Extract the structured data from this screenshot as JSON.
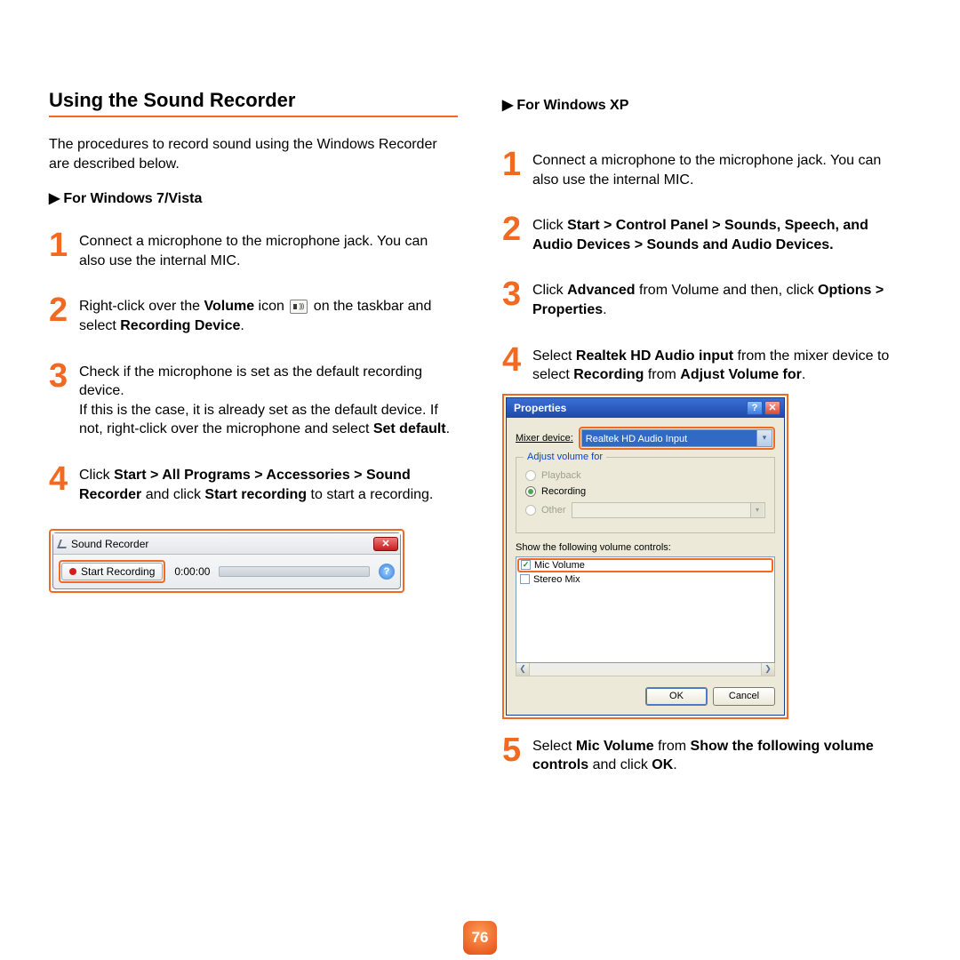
{
  "page_number": "76",
  "left": {
    "title": "Using the Sound Recorder",
    "intro": "The procedures to record sound using the Windows Recorder are described below.",
    "sub_heading": "For Windows 7/Vista",
    "steps": [
      {
        "num": "1",
        "text_plain": "Connect a microphone to the microphone jack. You can also use the internal MIC."
      },
      {
        "num": "2",
        "text_pre": "Right-click over the ",
        "text_b1": "Volume",
        "text_mid1": " icon ",
        "text_mid2": " on the taskbar and select ",
        "text_b2": "Recording Device",
        "text_post": "."
      },
      {
        "num": "3",
        "line1": "Check if the microphone is set as the default recording device.",
        "line2_a": "If this is the case, it is already set as the default device. If not, right-click over the microphone and select ",
        "line2_b": "Set default",
        "line2_c": "."
      },
      {
        "num": "4",
        "a": "Click ",
        "b": "Start > All Programs > Accessories > Sound Recorder",
        "c": " and click ",
        "d": "Start recording",
        "e": " to start a recording."
      }
    ],
    "recorder": {
      "title": "Sound Recorder",
      "start_label": "Start Recording",
      "time": "0:00:00"
    }
  },
  "right": {
    "sub_heading": "For Windows XP",
    "steps": [
      {
        "num": "1",
        "text_plain": "Connect a microphone to the microphone jack. You can also use the internal MIC."
      },
      {
        "num": "2",
        "a": "Click ",
        "b": "Start > Control Panel > Sounds, Speech, and Audio Devices > Sounds and Audio Devices."
      },
      {
        "num": "3",
        "a": "Click ",
        "b": "Advanced",
        "c": " from Volume and then, click ",
        "d": "Options > Properties",
        "e": "."
      },
      {
        "num": "4",
        "a": "Select ",
        "b": "Realtek HD Audio input",
        "c": " from the mixer device to select ",
        "d": "Recording",
        "e": " from ",
        "f": "Adjust Volume for",
        "g": "."
      },
      {
        "num": "5",
        "a": "Select ",
        "b": "Mic Volume",
        "c": " from ",
        "d": "Show the following volume controls",
        "e": " and click ",
        "f": "OK",
        "g": "."
      }
    ],
    "dialog": {
      "title": "Properties",
      "mixer_label": "Mixer device:",
      "mixer_value": "Realtek HD Audio Input",
      "fieldset_legend": "Adjust volume for",
      "radio_playback": "Playback",
      "radio_recording": "Recording",
      "radio_other": "Other",
      "show_label": "Show the following volume controls:",
      "item_mic": "Mic Volume",
      "item_stereo": "Stereo Mix",
      "ok": "OK",
      "cancel": "Cancel"
    }
  }
}
